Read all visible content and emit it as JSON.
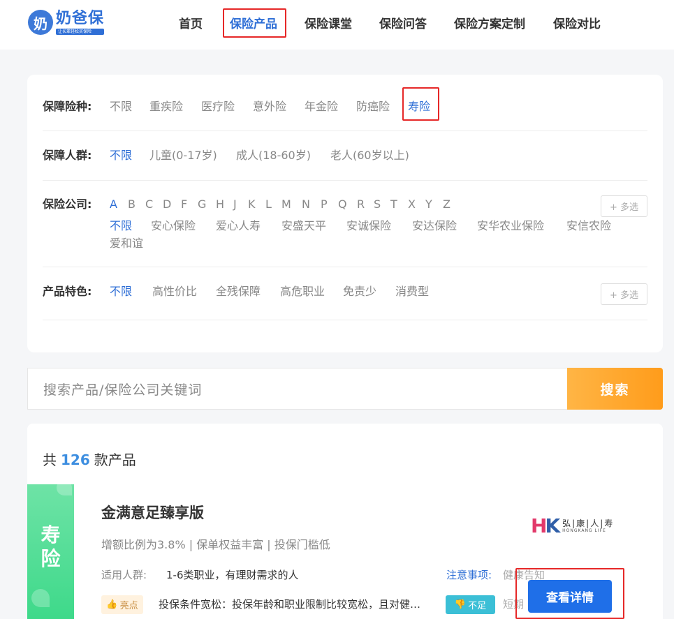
{
  "header": {
    "logo_badge": "奶",
    "logo_name": "奶爸保",
    "logo_slogan": "让长辈轻松买保险",
    "nav": [
      {
        "label": "首页"
      },
      {
        "label": "保险产品"
      },
      {
        "label": "保险课堂"
      },
      {
        "label": "保险问答"
      },
      {
        "label": "保险方案定制"
      },
      {
        "label": "保险对比"
      }
    ],
    "active_nav": "保险产品"
  },
  "filters": {
    "type": {
      "label": "保障险种:",
      "options": [
        "不限",
        "重疾险",
        "医疗险",
        "意外险",
        "年金险",
        "防癌险",
        "寿险"
      ],
      "selected": "寿险"
    },
    "crowd": {
      "label": "保障人群:",
      "options": [
        "不限",
        "儿童(0-17岁)",
        "成人(18-60岁)",
        "老人(60岁以上)"
      ],
      "selected": "不限"
    },
    "company": {
      "label": "保险公司:",
      "letters": [
        "A",
        "B",
        "C",
        "D",
        "F",
        "G",
        "H",
        "J",
        "K",
        "L",
        "M",
        "N",
        "P",
        "Q",
        "R",
        "S",
        "T",
        "X",
        "Y",
        "Z"
      ],
      "selected_letter": "A",
      "options": [
        "不限",
        "安心保险",
        "爱心人寿",
        "安盛天平",
        "安诚保险",
        "安达保险",
        "安华农业保险",
        "安信农险",
        "爱和谊"
      ],
      "selected": "不限",
      "multi_label": "+ 多选"
    },
    "feature": {
      "label": "产品特色:",
      "options": [
        "不限",
        "高性价比",
        "全残保障",
        "高危职业",
        "免责少",
        "消费型"
      ],
      "selected": "不限",
      "multi_label": "+ 多选"
    }
  },
  "search": {
    "placeholder": "搜索产品/保险公司关键词",
    "button_label": "搜索"
  },
  "results": {
    "prefix": "共",
    "count": "126",
    "suffix": "款产品"
  },
  "product": {
    "category_tag": "寿险",
    "title": "金满意足臻享版",
    "features": "增额比例为3.8% | 保单权益丰富 | 投保门槛低",
    "crowd_label": "适用人群:",
    "crowd_value": "1-6类职业，有理财需求的人",
    "note_label": "注意事项:",
    "note_value": "健康告知",
    "pros_tag": "亮点",
    "pros_text": "投保条件宽松：投保年龄和职业限制比较宽松，且对健康告知要求不高",
    "cons_tag": "不足",
    "cons_text": "短期",
    "company_logo_cn": "弘|康|人|寿",
    "company_logo_en": "HONGKANG LIFE",
    "detail_button": "查看详情"
  }
}
